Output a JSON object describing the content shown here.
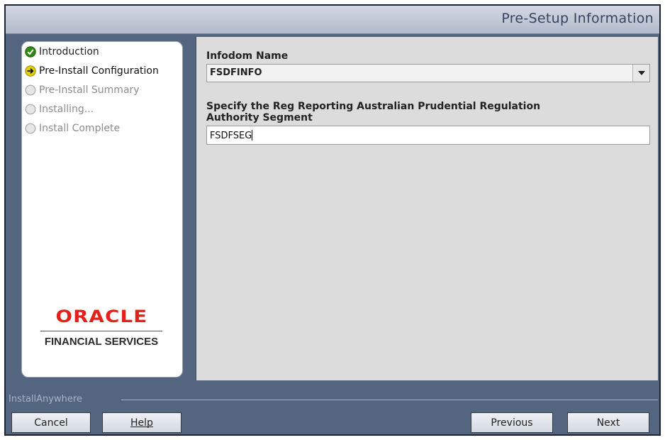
{
  "header": {
    "title": "Pre-Setup Information"
  },
  "steps": [
    {
      "label": "Introduction",
      "state": "done"
    },
    {
      "label": "Pre-Install Configuration",
      "state": "current"
    },
    {
      "label": "Pre-Install Summary",
      "state": "pending"
    },
    {
      "label": "Installing...",
      "state": "pending"
    },
    {
      "label": "Install Complete",
      "state": "pending"
    }
  ],
  "logo": {
    "brand": "ORACLE",
    "subtitle": "FINANCIAL SERVICES"
  },
  "form": {
    "infodom_label": "Infodom Name",
    "infodom_value": "FSDFINFO",
    "segment_label_line1": "Specify the Reg Reporting Australian Prudential Regulation",
    "segment_label_line2": "Authority Segment",
    "segment_value": "FSDFSEG"
  },
  "footer": {
    "installer_label": "InstallAnywhere",
    "cancel_label": "Cancel",
    "help_label": "Help",
    "previous_label": "Previous",
    "next_label": "Next"
  },
  "colors": {
    "window_bg": "#54657f",
    "header_text": "#36455e",
    "done_icon": "#2f8a12",
    "current_icon": "#e3d000",
    "oracle_red": "#e2221a"
  }
}
